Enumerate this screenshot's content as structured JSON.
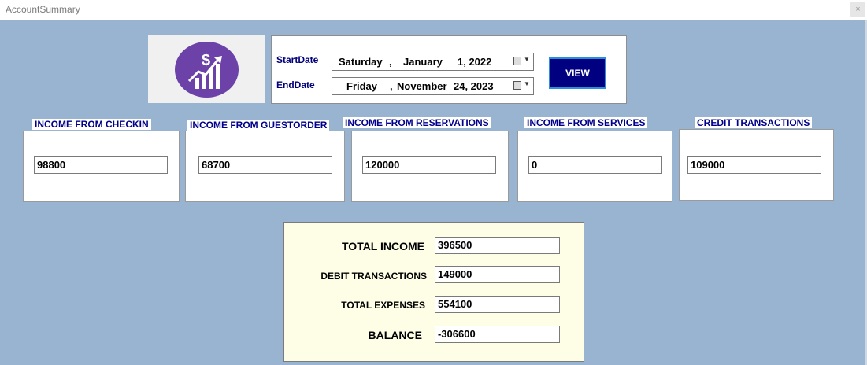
{
  "window": {
    "title": "AccountSummary",
    "close_glyph": "×"
  },
  "logo": {
    "icon": "money-growth-chart-icon",
    "color": "#6c41a8"
  },
  "dates": {
    "start_label": "StartDate",
    "end_label": "EndDate",
    "start": {
      "day": "Saturday",
      "sep": ",",
      "month": "January",
      "daynum": "1, 2022"
    },
    "end": {
      "day": "Friday",
      "sep": ",",
      "month": "November",
      "daynum": "24, 2023"
    },
    "view_label": "VIEW"
  },
  "cards": [
    {
      "label": "INCOME FROM CHECKIN",
      "value": "98800"
    },
    {
      "label": "INCOME FROM GUESTORDER",
      "value": "68700"
    },
    {
      "label": "INCOME FROM RESERVATIONS",
      "value": "120000"
    },
    {
      "label": "INCOME FROM SERVICES",
      "value": "0"
    },
    {
      "label": "CREDIT TRANSACTIONS",
      "value": "109000"
    }
  ],
  "summary": {
    "total_income_label": "TOTAL INCOME",
    "total_income": "396500",
    "debit_label": "DEBIT TRANSACTIONS",
    "debit": "149000",
    "total_expenses_label": "TOTAL EXPENSES",
    "total_expenses": "554100",
    "balance_label": "BALANCE",
    "balance": "-306600"
  },
  "colors": {
    "background": "#99b4d1",
    "label_text": "#00008b",
    "button": "#000080",
    "summary_bg": "#fefee6"
  }
}
